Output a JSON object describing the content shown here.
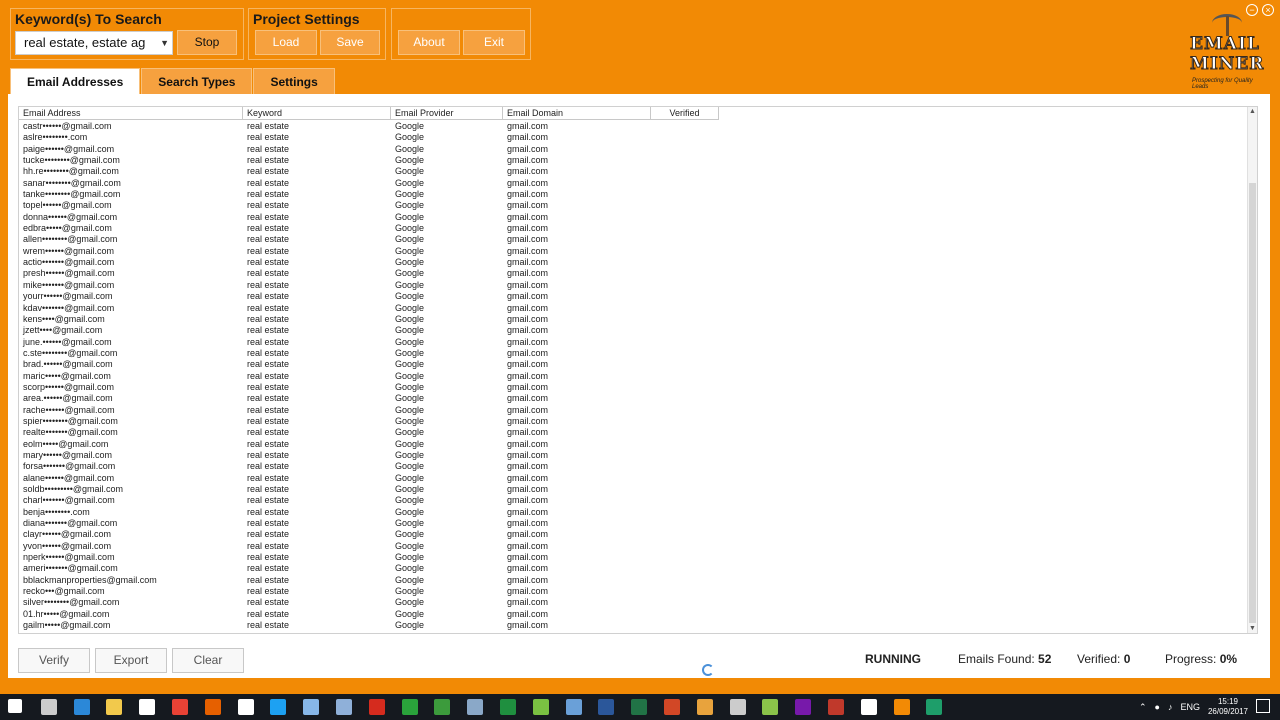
{
  "window": {
    "minimize": "−",
    "close": "×"
  },
  "keywords_group": {
    "title": "Keyword(s) To Search",
    "value": "real estate, estate ag",
    "stop_label": "Stop"
  },
  "project_group": {
    "title": "Project Settings",
    "load_label": "Load",
    "save_label": "Save"
  },
  "misc_group": {
    "about_label": "About",
    "exit_label": "Exit"
  },
  "logo": {
    "line1": "EMAIL",
    "line2": "MINER",
    "tagline": "Prospecting for Quality Leads"
  },
  "tabs": [
    {
      "label": "Email Addresses",
      "active": true
    },
    {
      "label": "Search Types",
      "active": false
    },
    {
      "label": "Settings",
      "active": false
    }
  ],
  "grid": {
    "columns": [
      "Email Address",
      "Keyword",
      "Email Provider",
      "Email Domain",
      "Verified"
    ],
    "rows": [
      [
        "castr••••••@gmail.com",
        "real estate",
        "Google",
        "gmail.com",
        ""
      ],
      [
        "aslre••••••••.com",
        "real estate",
        "Google",
        "gmail.com",
        ""
      ],
      [
        "paige••••••@gmail.com",
        "real estate",
        "Google",
        "gmail.com",
        ""
      ],
      [
        "tucke••••••••@gmail.com",
        "real estate",
        "Google",
        "gmail.com",
        ""
      ],
      [
        "hh.re••••••••@gmail.com",
        "real estate",
        "Google",
        "gmail.com",
        ""
      ],
      [
        "sanar••••••••@gmail.com",
        "real estate",
        "Google",
        "gmail.com",
        ""
      ],
      [
        "tanke••••••••@gmail.com",
        "real estate",
        "Google",
        "gmail.com",
        ""
      ],
      [
        "topel••••••@gmail.com",
        "real estate",
        "Google",
        "gmail.com",
        ""
      ],
      [
        "donna••••••@gmail.com",
        "real estate",
        "Google",
        "gmail.com",
        ""
      ],
      [
        "edbra•••••@gmail.com",
        "real estate",
        "Google",
        "gmail.com",
        ""
      ],
      [
        "allen••••••••@gmail.com",
        "real estate",
        "Google",
        "gmail.com",
        ""
      ],
      [
        "wrem••••••@gmail.com",
        "real estate",
        "Google",
        "gmail.com",
        ""
      ],
      [
        "actio•••••••@gmail.com",
        "real estate",
        "Google",
        "gmail.com",
        ""
      ],
      [
        "presh••••••@gmail.com",
        "real estate",
        "Google",
        "gmail.com",
        ""
      ],
      [
        "mike•••••••@gmail.com",
        "real estate",
        "Google",
        "gmail.com",
        ""
      ],
      [
        "yourr••••••@gmail.com",
        "real estate",
        "Google",
        "gmail.com",
        ""
      ],
      [
        "kdav•••••••@gmail.com",
        "real estate",
        "Google",
        "gmail.com",
        ""
      ],
      [
        "kens••••@gmail.com",
        "real estate",
        "Google",
        "gmail.com",
        ""
      ],
      [
        "jzett••••@gmail.com",
        "real estate",
        "Google",
        "gmail.com",
        ""
      ],
      [
        "june.••••••@gmail.com",
        "real estate",
        "Google",
        "gmail.com",
        ""
      ],
      [
        "c.ste••••••••@gmail.com",
        "real estate",
        "Google",
        "gmail.com",
        ""
      ],
      [
        "brad.••••••@gmail.com",
        "real estate",
        "Google",
        "gmail.com",
        ""
      ],
      [
        "maric•••••@gmail.com",
        "real estate",
        "Google",
        "gmail.com",
        ""
      ],
      [
        "scorp••••••@gmail.com",
        "real estate",
        "Google",
        "gmail.com",
        ""
      ],
      [
        "area.••••••@gmail.com",
        "real estate",
        "Google",
        "gmail.com",
        ""
      ],
      [
        "rache••••••@gmail.com",
        "real estate",
        "Google",
        "gmail.com",
        ""
      ],
      [
        "spier••••••••@gmail.com",
        "real estate",
        "Google",
        "gmail.com",
        ""
      ],
      [
        "realte•••••••@gmail.com",
        "real estate",
        "Google",
        "gmail.com",
        ""
      ],
      [
        "eolm•••••@gmail.com",
        "real estate",
        "Google",
        "gmail.com",
        ""
      ],
      [
        "mary••••••@gmail.com",
        "real estate",
        "Google",
        "gmail.com",
        ""
      ],
      [
        "forsa•••••••@gmail.com",
        "real estate",
        "Google",
        "gmail.com",
        ""
      ],
      [
        "alane••••••@gmail.com",
        "real estate",
        "Google",
        "gmail.com",
        ""
      ],
      [
        "soldb•••••••••@gmail.com",
        "real estate",
        "Google",
        "gmail.com",
        ""
      ],
      [
        "charl•••••••@gmail.com",
        "real estate",
        "Google",
        "gmail.com",
        ""
      ],
      [
        "benja••••••••.com",
        "real estate",
        "Google",
        "gmail.com",
        ""
      ],
      [
        "diana•••••••@gmail.com",
        "real estate",
        "Google",
        "gmail.com",
        ""
      ],
      [
        "clayr••••••@gmail.com",
        "real estate",
        "Google",
        "gmail.com",
        ""
      ],
      [
        "yvon••••••@gmail.com",
        "real estate",
        "Google",
        "gmail.com",
        ""
      ],
      [
        "nperk••••••@gmail.com",
        "real estate",
        "Google",
        "gmail.com",
        ""
      ],
      [
        "ameri•••••••@gmail.com",
        "real estate",
        "Google",
        "gmail.com",
        ""
      ],
      [
        "bblackmanproperties@gmail.com",
        "real estate",
        "Google",
        "gmail.com",
        ""
      ],
      [
        "recko•••@gmail.com",
        "real estate",
        "Google",
        "gmail.com",
        ""
      ],
      [
        "silver••••••••@gmail.com",
        "real estate",
        "Google",
        "gmail.com",
        ""
      ],
      [
        "01.hr•••••@gmail.com",
        "real estate",
        "Google",
        "gmail.com",
        ""
      ],
      [
        "gailm•••••@gmail.com",
        "real estate",
        "Google",
        "gmail.com",
        ""
      ]
    ]
  },
  "bottom_buttons": {
    "verify_label": "Verify",
    "export_label": "Export",
    "clear_label": "Clear"
  },
  "status": {
    "state": "RUNNING",
    "emails_found_label": "Emails Found:",
    "emails_found_value": "52",
    "verified_label": "Verified:",
    "verified_value": "0",
    "progress_label": "Progress:",
    "progress_value": "0%"
  },
  "taskbar": {
    "language": "ENG",
    "time": "15:19",
    "date": "26/09/2017",
    "icons": [
      "windows-start",
      "task-view",
      "edge",
      "file-explorer",
      "store",
      "chrome",
      "firefox",
      "notepad",
      "twitter",
      "app",
      "app",
      "filezilla",
      "app",
      "app",
      "app",
      "app",
      "app",
      "app",
      "word",
      "excel",
      "powerpoint",
      "app",
      "calculator",
      "app",
      "onenote",
      "app",
      "mail",
      "email-miner",
      "app"
    ],
    "icon_colors": [
      "#ffffff",
      "#cccccc",
      "#2b88d8",
      "#f2c94c",
      "#ffffff",
      "#e94235",
      "#e66000",
      "#ffffff",
      "#1da1f2",
      "#87b7e8",
      "#8fb0d9",
      "#d52b1e",
      "#2aa33b",
      "#3c9b3c",
      "#8aa8c8",
      "#1f8f3f",
      "#7ac142",
      "#6aa0d8",
      "#2b579a",
      "#217346",
      "#d24726",
      "#e8a33d",
      "#cccccc",
      "#8bc34a",
      "#7719aa",
      "#c0392b",
      "#ffffff",
      "#f28a05",
      "#1e9e6a"
    ]
  }
}
